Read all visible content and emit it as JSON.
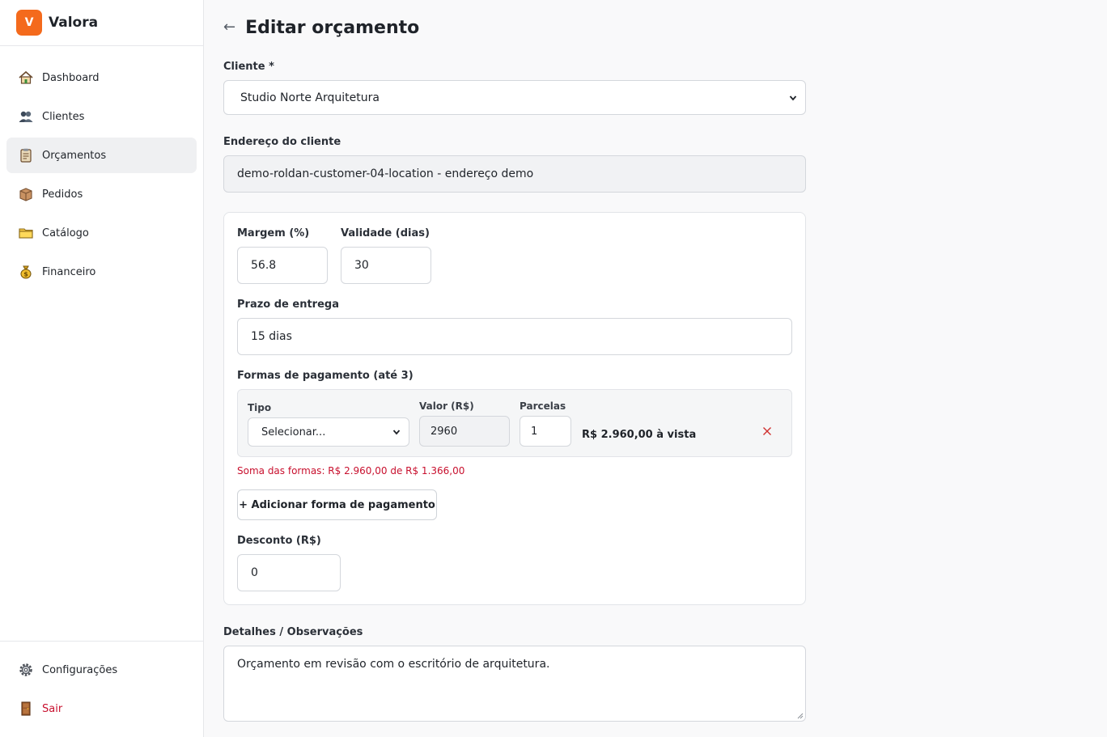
{
  "brand": {
    "logo_letter": "V",
    "name": "Valora",
    "logo_color": "#f46a1c"
  },
  "nav": {
    "items": [
      {
        "label": "Dashboard",
        "icon": "house-icon"
      },
      {
        "label": "Clientes",
        "icon": "people-icon"
      },
      {
        "label": "Orçamentos",
        "icon": "clipboard-icon",
        "active": true
      },
      {
        "label": "Pedidos",
        "icon": "package-icon"
      },
      {
        "label": "Catálogo",
        "icon": "folder-icon"
      },
      {
        "label": "Financeiro",
        "icon": "money-bag-icon"
      }
    ],
    "bottom": [
      {
        "label": "Configurações",
        "icon": "gear-icon"
      },
      {
        "label": "Sair",
        "icon": "door-icon"
      }
    ]
  },
  "page": {
    "title": "Editar orçamento"
  },
  "form": {
    "cliente": {
      "label": "Cliente *",
      "value": "Studio Norte Arquitetura"
    },
    "endereco": {
      "label": "Endereço do cliente",
      "value": "demo-roldan-customer-04-location - endereço demo"
    },
    "margem": {
      "label": "Margem (%)",
      "value": "56.8"
    },
    "validade": {
      "label": "Validade (dias)",
      "value": "30"
    },
    "prazo": {
      "label": "Prazo de entrega",
      "value": "15 dias"
    },
    "pagamento": {
      "label": "Formas de pagamento (até 3)",
      "tipo_label": "Tipo",
      "tipo_value": "Selecionar...",
      "valor_label": "Valor (R$)",
      "valor_value": "2960",
      "parcelas_label": "Parcelas",
      "parcelas_value": "1",
      "summary": "R$ 2.960,00 à vista",
      "error": "Soma das formas: R$ 2.960,00 de R$ 1.366,00",
      "add_button": "+ Adicionar forma de pagamento"
    },
    "desconto": {
      "label": "Desconto (R$)",
      "value": "0"
    },
    "detalhes": {
      "label": "Detalhes / Observações",
      "value": "Orçamento em revisão com o escritório de arquitetura."
    }
  },
  "colors": {
    "error": "#c8102e",
    "accent": "#f46a1c"
  }
}
